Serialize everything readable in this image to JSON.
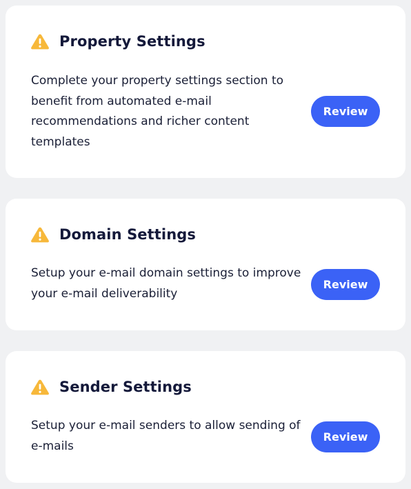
{
  "cards": [
    {
      "title": "Property Settings",
      "description": "Complete your property settings section to benefit from automated e-mail recommendations and richer content templates",
      "button_label": "Review",
      "icon": "warning-icon"
    },
    {
      "title": "Domain Settings",
      "description": "Setup your e-mail domain settings to improve your e-mail deliverability",
      "button_label": "Review",
      "icon": "warning-icon"
    },
    {
      "title": "Sender Settings",
      "description": "Setup your e-mail senders to allow sending of e-mails",
      "button_label": "Review",
      "icon": "warning-icon"
    }
  ],
  "colors": {
    "page_background": "#f0f1f3",
    "card_background": "#ffffff",
    "title": "#14193a",
    "text": "#1a1f36",
    "warning": "#f7b83a",
    "button": "#3b62f6",
    "button_text": "#ffffff"
  }
}
